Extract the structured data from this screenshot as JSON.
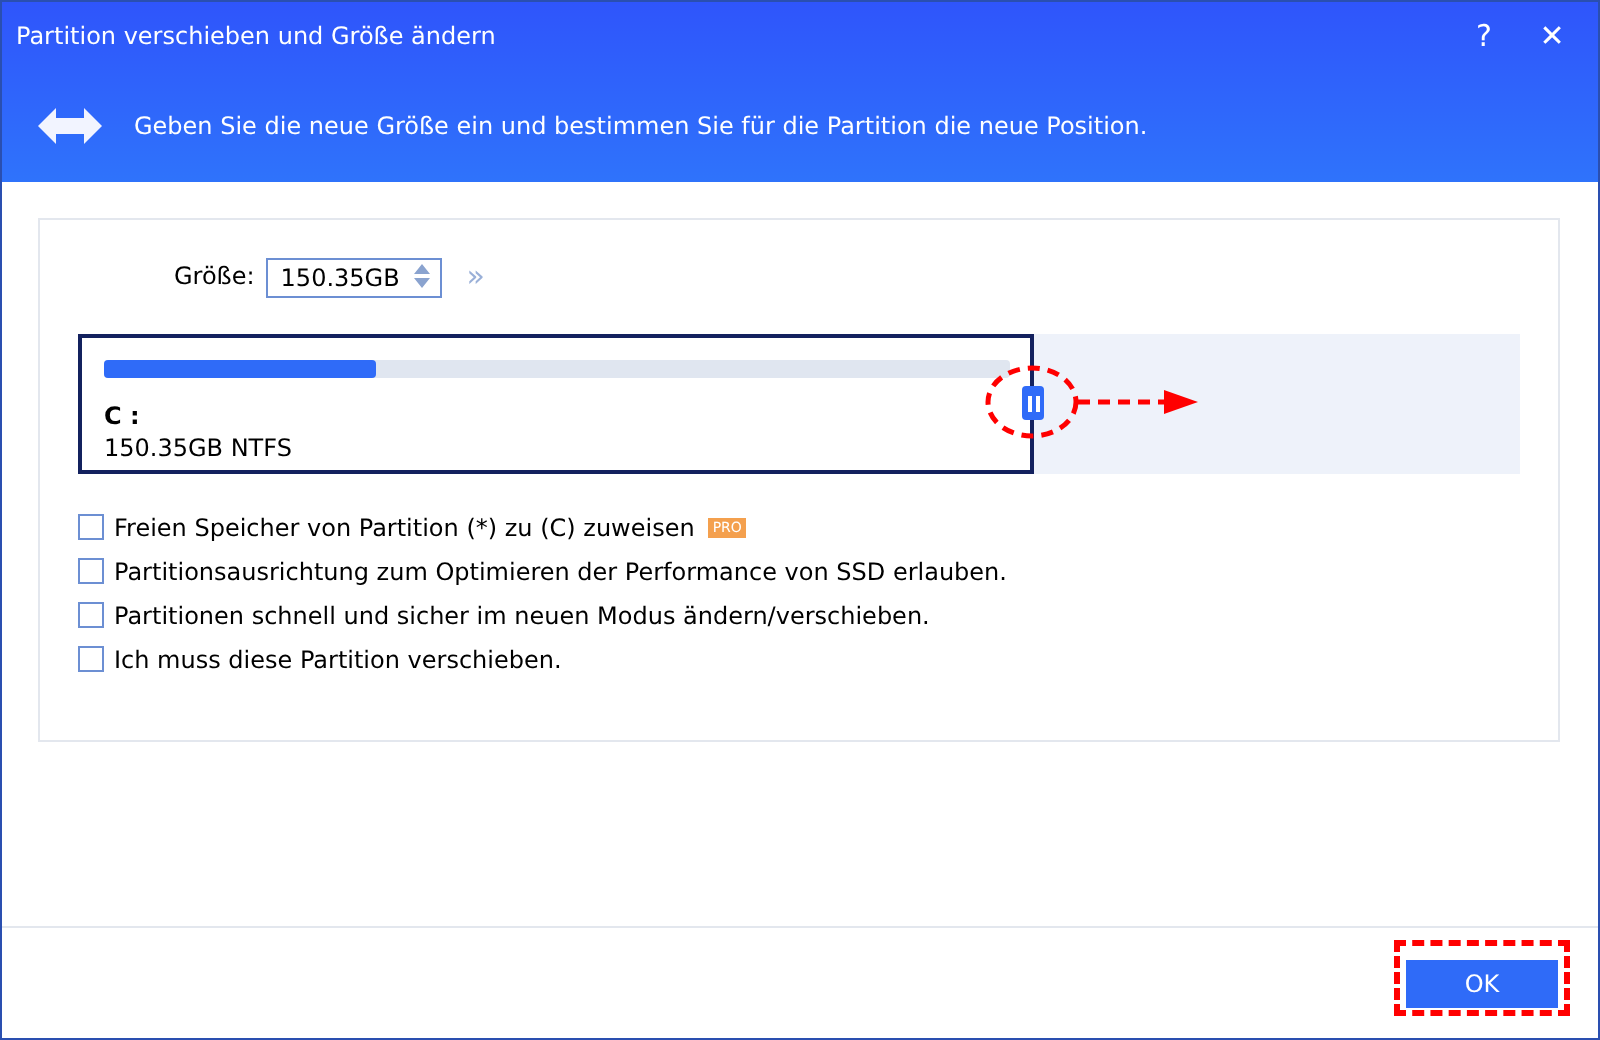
{
  "window": {
    "title": "Partition verschieben und Größe ändern",
    "help": "?",
    "close": "✕"
  },
  "header": {
    "text": "Geben Sie die neue Größe ein und bestimmen Sie für die Partition die neue Position."
  },
  "size": {
    "label": "Größe:",
    "value": "150.35GB",
    "more": "»"
  },
  "partition": {
    "name": "C :",
    "info": "150.35GB NTFS",
    "level": 0.3
  },
  "options": [
    {
      "label": "Freien Speicher von Partition (*) zu (C) zuweisen",
      "checked": false,
      "badge": "PRO"
    },
    {
      "label": "Partitionsausrichtung zum Optimieren der Performance von SSD erlauben.",
      "checked": false
    },
    {
      "label": "Partitionen schnell und sicher im neuen Modus ändern/verschieben.",
      "checked": false
    },
    {
      "label": "Ich muss diese Partition verschieben.",
      "checked": false
    }
  ],
  "ok": "OK"
}
